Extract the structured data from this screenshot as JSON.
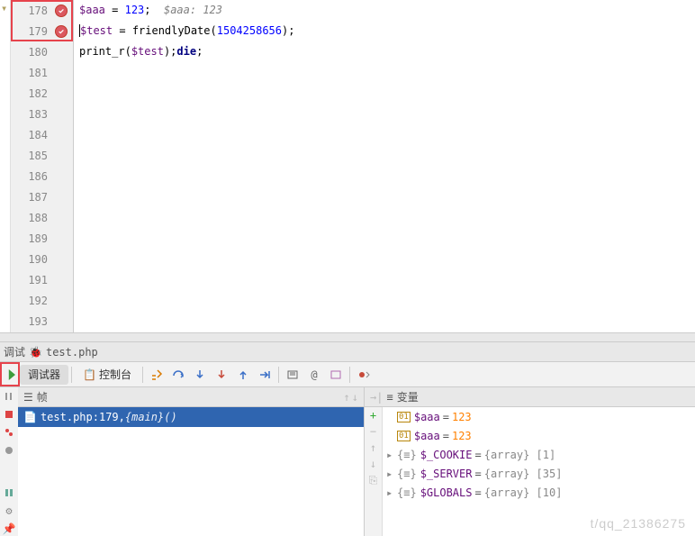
{
  "editor": {
    "lines": [
      {
        "n": 178,
        "bp": true
      },
      {
        "n": 179,
        "bp": true
      },
      {
        "n": 180
      },
      {
        "n": 181
      },
      {
        "n": 182
      },
      {
        "n": 183
      },
      {
        "n": 184
      },
      {
        "n": 185
      },
      {
        "n": 186
      },
      {
        "n": 187
      },
      {
        "n": 188
      },
      {
        "n": 189
      },
      {
        "n": 190
      },
      {
        "n": 191
      },
      {
        "n": 192
      },
      {
        "n": 193
      }
    ],
    "code178": {
      "v": "$aaa",
      "eq": " = ",
      "num": "123",
      "sc": ";",
      "cm": "  $aaa: 123"
    },
    "code179": {
      "v": "$test",
      "eq": " = ",
      "fn": "friendlyDate",
      "op": "(",
      "arg": "1504258656",
      "cp": ");"
    },
    "code180": {
      "fn": "print_r",
      "op": "(",
      "v": "$test",
      "cp": ");",
      "kw": "die",
      "sc": ";"
    }
  },
  "debug": {
    "title_prefix": "调试",
    "title_file": "test.php",
    "tabs": {
      "debugger": "调试器",
      "console": "控制台"
    },
    "frames_header": "帧",
    "vars_header": "变量",
    "frame": {
      "file": "test.php:179, ",
      "fn": "{main}()"
    },
    "vars": [
      {
        "icon": "int",
        "k": "$aaa",
        "eq": "=",
        "v": "123",
        "num": true
      },
      {
        "icon": "int",
        "k": "$aaa",
        "eq": "=",
        "v": "123",
        "num": true
      },
      {
        "icon": "arr",
        "exp": true,
        "k": "$_COOKIE",
        "eq": "=",
        "v": "{array} [1]"
      },
      {
        "icon": "arr",
        "exp": true,
        "k": "$_SERVER",
        "eq": "=",
        "v": "{array} [35]"
      },
      {
        "icon": "arr",
        "exp": true,
        "k": "$GLOBALS",
        "eq": "=",
        "v": "{array} [10]"
      }
    ]
  },
  "watermark": "t/qq_21386275"
}
